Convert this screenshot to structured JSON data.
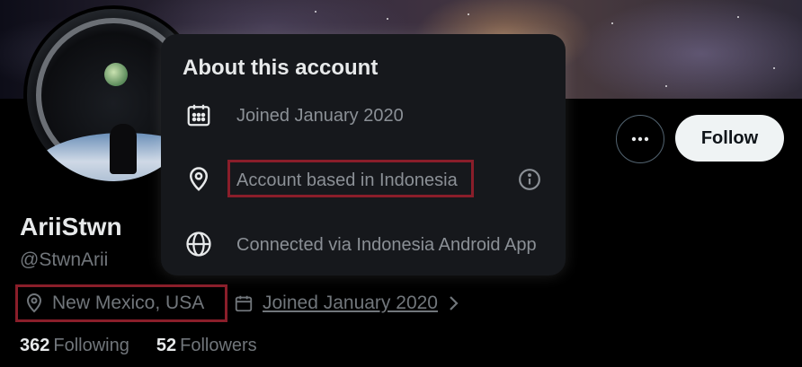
{
  "profile": {
    "display_name": "AriiStwn",
    "handle": "@StwnArii",
    "location": "New Mexico, USA",
    "joined": "Joined January 2020",
    "following_count": "362",
    "following_label": "Following",
    "followers_count": "52",
    "followers_label": "Followers"
  },
  "actions": {
    "follow_label": "Follow"
  },
  "about_popup": {
    "title": "About this account",
    "joined": "Joined January 2020",
    "based_in": "Account based in Indonesia",
    "connected_via": "Connected via Indonesia Android App"
  },
  "colors": {
    "highlight_border": "#8a1e2a",
    "secondary_text": "#71767b",
    "popup_bg": "#16181c"
  },
  "icons": [
    "calendar-icon",
    "location-pin-icon",
    "globe-icon",
    "info-icon",
    "more-icon",
    "chevron-right-icon"
  ]
}
